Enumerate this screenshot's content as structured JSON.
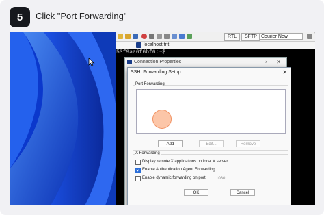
{
  "step": {
    "number": "5",
    "instruction": "Click \"Port Forwarding\""
  },
  "toolbar": {
    "rtl_label": "RTL",
    "sftp_label": "SFTP",
    "font_select": "Courier New"
  },
  "terminal": {
    "tab_label": "localhost.tnt",
    "prompt": "53f9aa6f6bf6:~$"
  },
  "outer_dialog": {
    "title": "Connection Properties",
    "help": "?",
    "close": "✕"
  },
  "inner_dialog": {
    "title": "SSH: Forwarding Setup",
    "close": "✕",
    "port_group_label": "Port Forwarding",
    "add_label": "Add",
    "edit_label": "Edit...",
    "remove_label": "Remove",
    "x_group_label": "X Forwarding",
    "options": [
      {
        "label": "Display remote X applications on local X server",
        "checked": false
      },
      {
        "label": "Enable Authentication Agent Forwarding",
        "checked": true
      },
      {
        "label": "Enable dynamic forwarding on port",
        "checked": false
      }
    ],
    "port_value": "1080",
    "ok_label": "OK",
    "cancel_label": "Cancel"
  },
  "colors": {
    "accent": "#2b6ed8",
    "desktop": "#0d3bd0",
    "marker": "#f7a26f"
  }
}
